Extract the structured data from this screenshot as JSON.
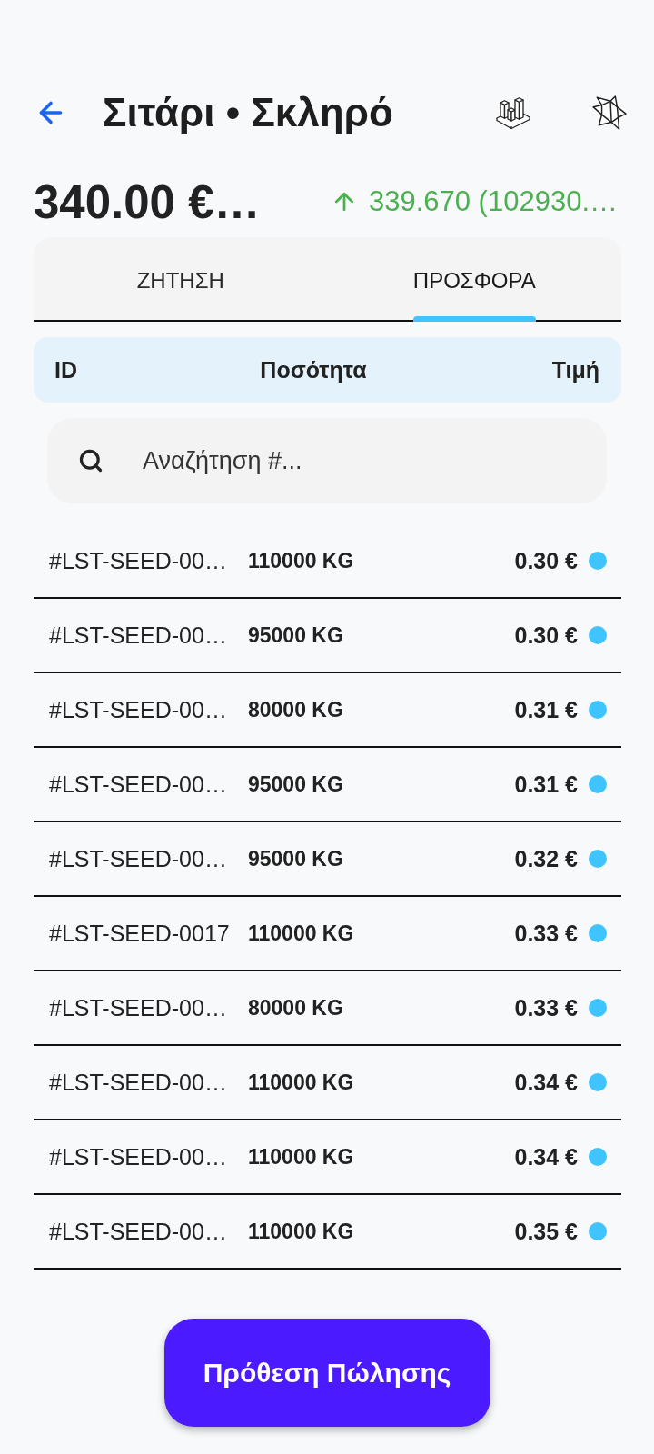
{
  "header": {
    "title": "Σιτάρι • Σκληρό"
  },
  "price": {
    "value": "340.00 €…",
    "change": "339.670 (102930.…"
  },
  "tabs": [
    {
      "label": "ΖΗΤΗΣΗ",
      "selected": false
    },
    {
      "label": "ΠΡΟΣΦΟΡΑ",
      "selected": true
    }
  ],
  "table": {
    "columns": [
      "ID",
      "Ποσότητα",
      "Τιμή"
    ],
    "search": {
      "placeholder": "Αναζήτηση #..."
    },
    "rows": [
      {
        "id": "#LST-SEED-00…",
        "quantity": "110000 KG",
        "price": "0.30 €",
        "color": "#40c4ff"
      },
      {
        "id": "#LST-SEED-00…",
        "quantity": "95000 KG",
        "price": "0.30 €",
        "color": "#40c4ff"
      },
      {
        "id": "#LST-SEED-00…",
        "quantity": "80000 KG",
        "price": "0.31 €",
        "color": "#40c4ff"
      },
      {
        "id": "#LST-SEED-00…",
        "quantity": "95000 KG",
        "price": "0.31 €",
        "color": "#40c4ff"
      },
      {
        "id": "#LST-SEED-00…",
        "quantity": "95000 KG",
        "price": "0.32 €",
        "color": "#40c4ff"
      },
      {
        "id": "#LST-SEED-0017",
        "quantity": "110000 KG",
        "price": "0.33 €",
        "color": "#40c4ff"
      },
      {
        "id": "#LST-SEED-00…",
        "quantity": "80000 KG",
        "price": "0.33 €",
        "color": "#40c4ff"
      },
      {
        "id": "#LST-SEED-00…",
        "quantity": "110000 KG",
        "price": "0.34 €",
        "color": "#40c4ff"
      },
      {
        "id": "#LST-SEED-00…",
        "quantity": "110000 KG",
        "price": "0.34 €",
        "color": "#40c4ff"
      },
      {
        "id": "#LST-SEED-00…",
        "quantity": "110000 KG",
        "price": "0.35 €",
        "color": "#40c4ff"
      }
    ]
  },
  "action_button": {
    "label": "Πρόθεση Πώλησης"
  }
}
